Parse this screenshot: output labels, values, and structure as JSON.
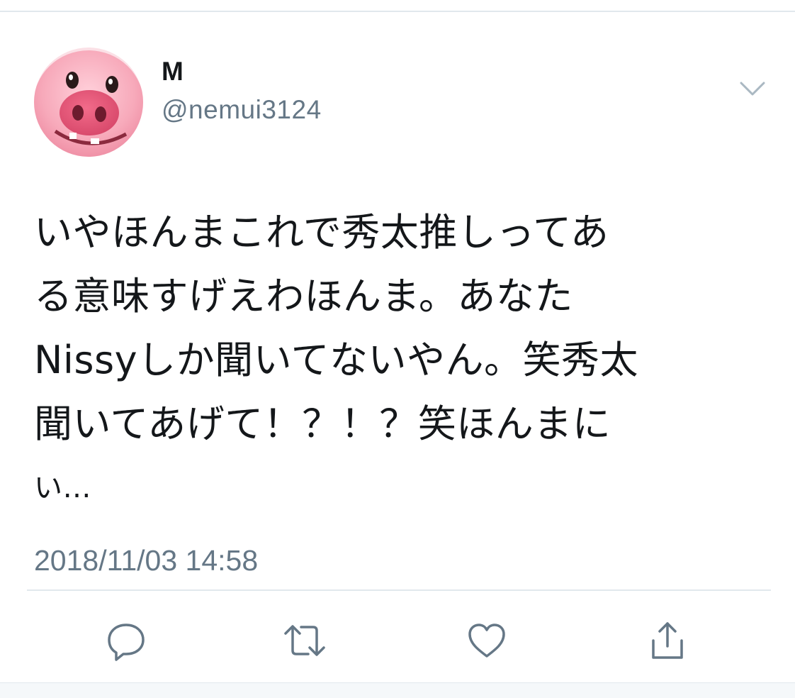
{
  "tweet": {
    "author": {
      "name": "M",
      "handle": "@nemui3124"
    },
    "text_lines": [
      "いやほんまこれで秀太推しってあ",
      "る意味すげえわほんま。あなた",
      "Nissyしか聞いてないやん。笑秀太",
      "聞いてあげて！？！？笑ほんまに",
      "い…"
    ],
    "timestamp": "2018/11/03 14:58",
    "actions": [
      {
        "icon": "reply-icon"
      },
      {
        "icon": "retweet-icon"
      },
      {
        "icon": "like-icon"
      },
      {
        "icon": "share-icon"
      }
    ]
  },
  "colors": {
    "text": "#14171a",
    "secondary": "#657786",
    "border": "#e1e8ed",
    "avatar_pink": "#f5a6b4"
  }
}
